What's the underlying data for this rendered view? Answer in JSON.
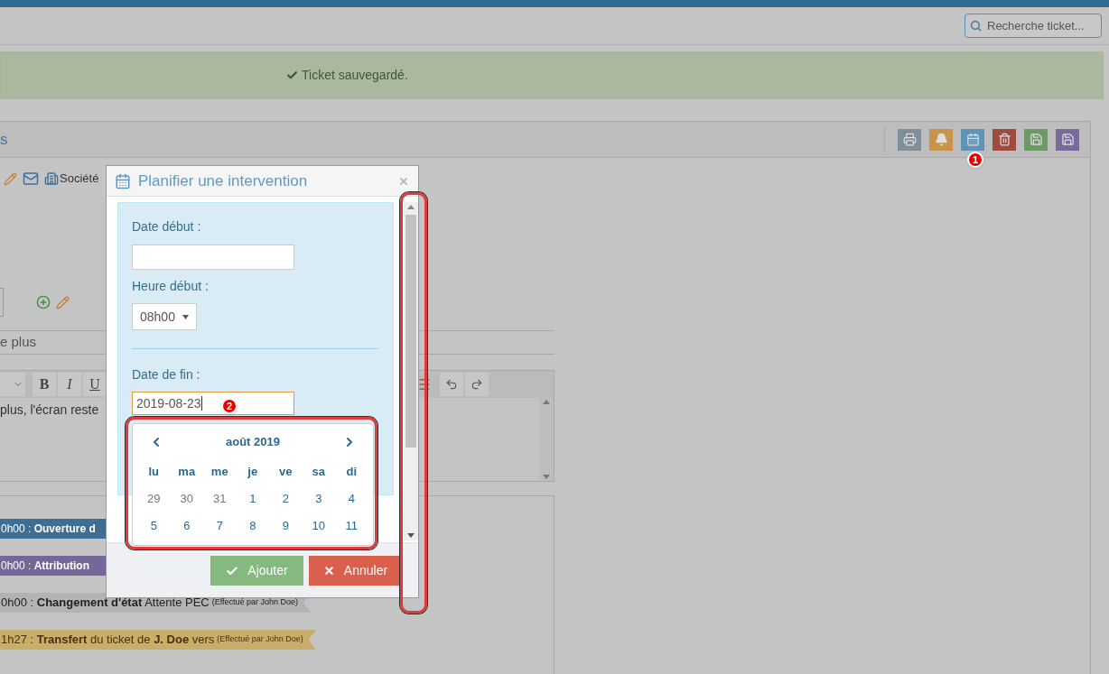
{
  "header": {
    "search": {
      "placeholder": "Recherche ticket..."
    }
  },
  "alert": {
    "text": "Ticket sauvegardé."
  },
  "panel": {
    "title": "s",
    "toolbar": [
      {
        "kind": "print",
        "color": "#7f8e99"
      },
      {
        "kind": "bell",
        "color": "#c9944a"
      },
      {
        "kind": "calendar",
        "color": "#5f93b8"
      },
      {
        "kind": "trash",
        "color": "#a14a40"
      },
      {
        "kind": "save",
        "color": "#6d9966"
      },
      {
        "kind": "save",
        "color": "#7a6a9b"
      }
    ],
    "company": "Société",
    "field_value": "e plus",
    "editor": {
      "format_buttons": [
        "B",
        "I",
        "U"
      ],
      "text": "plus, l'écran reste"
    },
    "timeline": [
      {
        "text": "0h00 : **Ouverture d**",
        "color": "#3f6e95"
      },
      {
        "text": "0h00 : **Attribution**",
        "color": "#75679a"
      },
      {
        "text": "0h00 : **Changement d'état** Attente PEC",
        "by": "(Effectué par John Doe)",
        "color": "#b3b3b3"
      },
      {
        "text": "1h27 : **Transfert** du ticket de **J. Doe** vers",
        "by": "(Effectué par John Doe)",
        "color": "#c9ad6a"
      }
    ]
  },
  "modal": {
    "title": "Planifier une intervention",
    "start_date": {
      "label": "Date début :"
    },
    "start_time": {
      "label": "Heure début :",
      "value": "08h00"
    },
    "end_date": {
      "label": "Date de fin :",
      "value": "2019-08-23",
      "focused": true
    },
    "datepicker": {
      "month": "août 2019",
      "weekdays": [
        "lu",
        "ma",
        "me",
        "je",
        "ve",
        "sa",
        "di"
      ],
      "weeks": [
        [
          {
            "day": "29",
            "outside": true
          },
          {
            "day": "30",
            "outside": true
          },
          {
            "day": "31",
            "outside": true
          },
          {
            "day": "1",
            "outside": false
          },
          {
            "day": "2",
            "outside": false
          },
          {
            "day": "3",
            "outside": false
          },
          {
            "day": "4",
            "outside": false
          }
        ],
        [
          {
            "day": "5",
            "outside": false
          },
          {
            "day": "6",
            "outside": false
          },
          {
            "day": "7",
            "outside": false
          },
          {
            "day": "8",
            "outside": false
          },
          {
            "day": "9",
            "outside": false
          },
          {
            "day": "10",
            "outside": false
          },
          {
            "day": "11",
            "outside": false
          }
        ]
      ]
    },
    "buttons": [
      {
        "kind": "confirm",
        "label": "Ajouter"
      },
      {
        "kind": "cancel",
        "label": "Annuler"
      }
    ]
  },
  "annotations": [
    {
      "number": "1"
    },
    {
      "number": "2"
    }
  ]
}
